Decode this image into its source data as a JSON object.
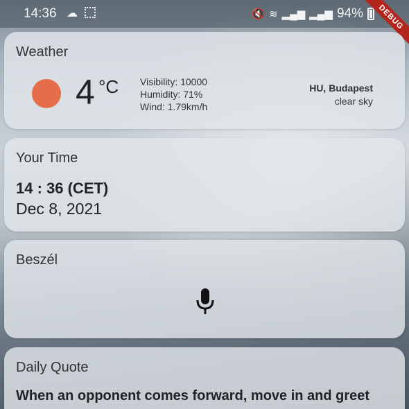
{
  "status": {
    "time": "14:36",
    "battery": "94%",
    "icons": [
      "cloud-icon",
      "screenshot-icon",
      "mute-icon",
      "wifi-icon",
      "signal-icon",
      "signal-icon",
      "battery-icon"
    ]
  },
  "debug_banner": "DEBUG",
  "weather": {
    "title": "Weather",
    "temperature": "4",
    "unit": "°C",
    "visibility": "Visibility: 10000",
    "humidity": "Humidity: 71%",
    "wind": "Wind: 1.79km/h",
    "location": "HU, Budapest",
    "condition": "clear sky",
    "sun_color": "#e66d4a"
  },
  "time": {
    "title": "Your Time",
    "clock": "14 : 36 (CET)",
    "date": "Dec 8, 2021"
  },
  "speak": {
    "title": "Beszél",
    "icon": "microphone-icon"
  },
  "quote": {
    "title": "Daily Quote",
    "text": "When an opponent comes forward, move in and greet"
  }
}
